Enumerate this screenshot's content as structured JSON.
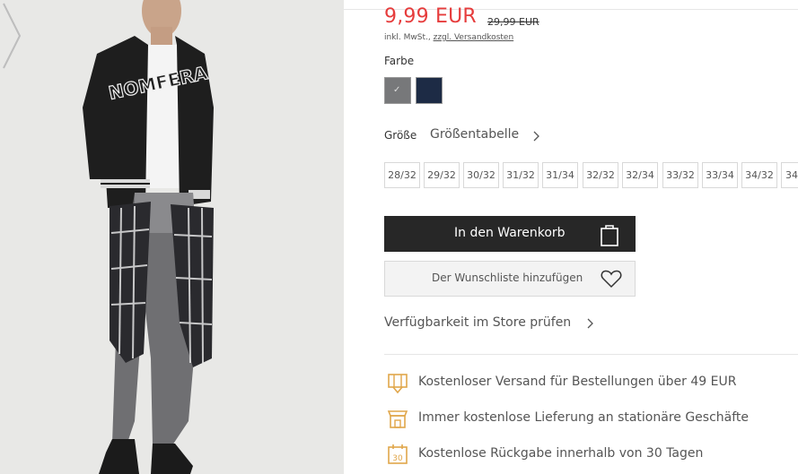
{
  "price": {
    "current": "9,99 EUR",
    "old": "29,99 EUR",
    "tax_prefix": "inkl. MwSt., ",
    "shipping_link": "zzgl. Versandkosten"
  },
  "color_section": {
    "label": "Farbe",
    "swatches": [
      {
        "name": "grau",
        "hex": "#77787a",
        "selected": true
      },
      {
        "name": "dunkelblau",
        "hex": "#1d2b45",
        "selected": false
      }
    ]
  },
  "size_section": {
    "label": "Größe",
    "size_table_link": "Größentabelle",
    "sizes": [
      "28/32",
      "29/32",
      "30/32",
      "31/32",
      "31/34",
      "32/32",
      "32/34",
      "33/32",
      "33/34",
      "34/32",
      "34"
    ]
  },
  "actions": {
    "cart_label": "In den Warenkorb",
    "wishlist_label": "Der Wunschliste hinzufügen",
    "store_availability": "Verfügbarkeit im Store prüfen"
  },
  "benefits": [
    {
      "icon": "delivery-box-icon",
      "text": "Kostenloser Versand für Bestellungen über 49 EUR"
    },
    {
      "icon": "store-icon",
      "text": "Immer kostenlose Lieferung an stationäre Geschäfte"
    },
    {
      "icon": "calendar-30-icon",
      "text": "Kostenlose Rückgabe innerhalb von 30 Tagen"
    }
  ],
  "colors": {
    "price_red": "#e63c3c",
    "accent_gold": "#e0a64a",
    "button_dark": "#272727"
  },
  "gallery": {
    "jacket_lettering": "NOMFERA"
  }
}
